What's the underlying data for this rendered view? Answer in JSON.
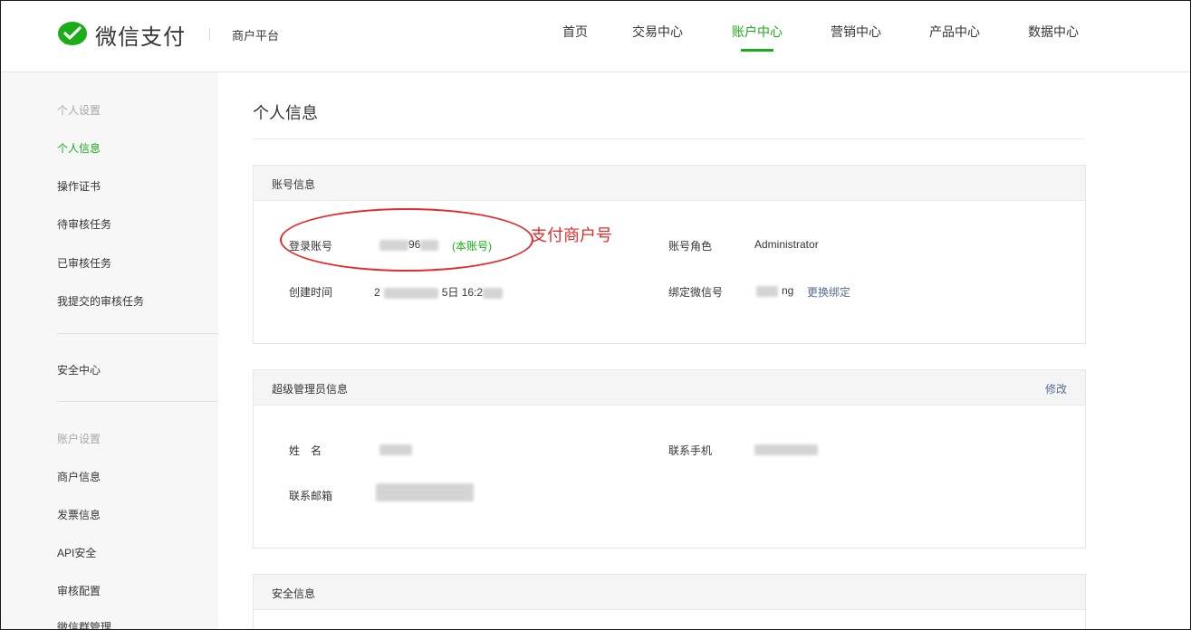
{
  "header": {
    "brand": "微信支付",
    "platform": "商户平台",
    "nav": [
      {
        "label": "首页",
        "active": false
      },
      {
        "label": "交易中心",
        "active": false
      },
      {
        "label": "账户中心",
        "active": true
      },
      {
        "label": "营销中心",
        "active": false
      },
      {
        "label": "产品中心",
        "active": false
      },
      {
        "label": "数据中心",
        "active": false
      }
    ]
  },
  "sidebar": {
    "group1": "个人设置",
    "items1": [
      "个人信息",
      "操作证书",
      "待审核任务",
      "已审核任务",
      "我提交的审核任务"
    ],
    "security_center": "安全中心",
    "group2": "账户设置",
    "items2": [
      "商户信息",
      "发票信息",
      "API安全",
      "审核配置",
      "微信群管理"
    ]
  },
  "main": {
    "page_title": "个人信息",
    "account_card": {
      "title": "账号信息",
      "login_label": "登录账号",
      "login_value_visible": "96",
      "login_tag": "(本账号)",
      "created_label": "创建时间",
      "created_value_prefix": "2",
      "created_value_visible": "5日 16:2",
      "role_label": "账号角色",
      "role_value": "Administrator",
      "wechat_label": "绑定微信号",
      "wechat_value_visible": "ng",
      "wechat_action": "更换绑定"
    },
    "admin_card": {
      "title": "超级管理员信息",
      "action": "修改",
      "name_label": "姓　名",
      "phone_label": "联系手机",
      "email_label": "联系邮箱"
    },
    "security_card": {
      "title": "安全信息"
    }
  },
  "annotation": {
    "text": "支付商户号",
    "color": "#e32b2b"
  },
  "colors": {
    "accent": "#1aad19",
    "link": "#576b95",
    "annotation": "#e32b2b"
  }
}
